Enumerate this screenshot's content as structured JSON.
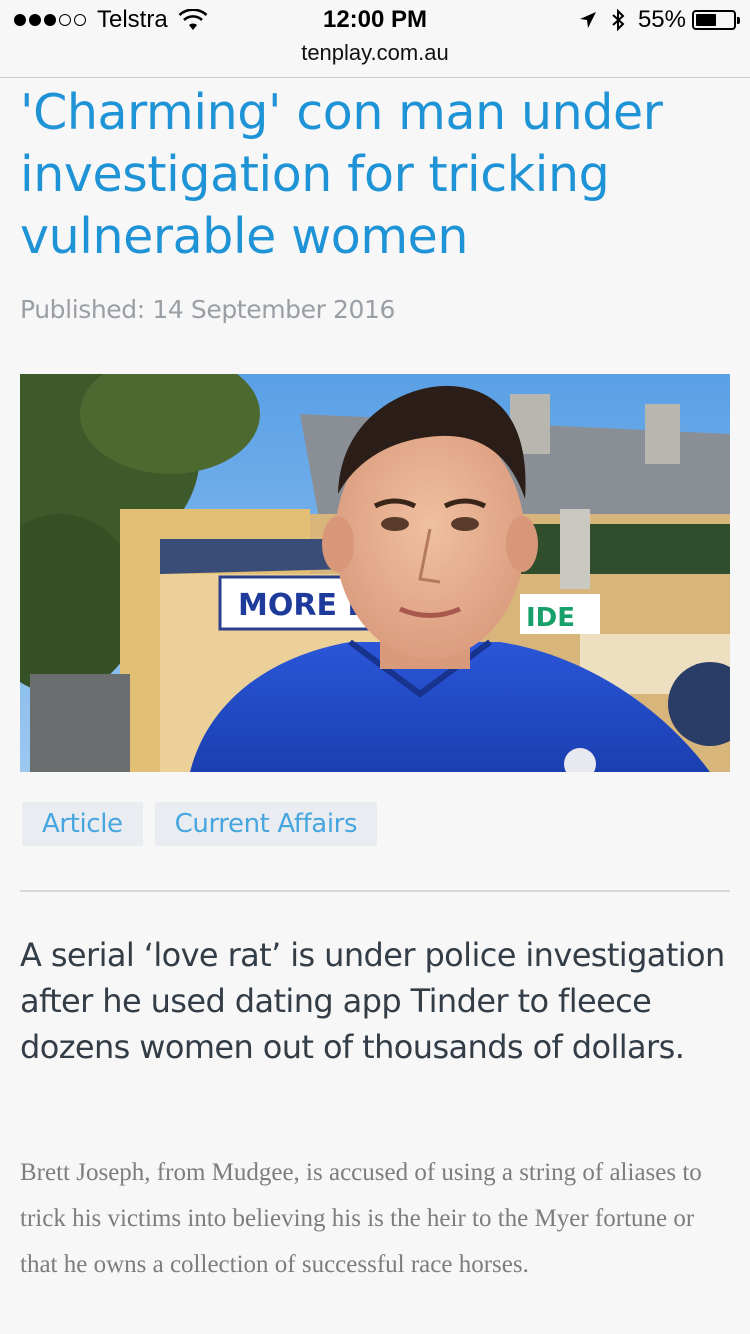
{
  "status_bar": {
    "carrier": "Telstra",
    "time": "12:00 PM",
    "battery": "55%",
    "battery_level": 0.55,
    "signal_bars_filled": 3,
    "signal_bars_total": 5,
    "icons": [
      "signal-dots-icon",
      "wifi-icon",
      "location-arrow-icon",
      "bluetooth-icon",
      "battery-icon"
    ]
  },
  "browser": {
    "url": "tenplay.com.au"
  },
  "article": {
    "headline": "'Charming' con man under investigation for tricking vulnerable women",
    "published": "Published: 14 September 2016",
    "tags": [
      "Article",
      "Current Affairs"
    ],
    "lead": "A serial ‘love rat’ is under police investigation after he used dating app Tinder to fleece dozens women out of thousands of dollars.",
    "body": "Brett Joseph, from Mudgee, is accused of using a string of aliases to trick his victims into believing his is the heir to the Myer fortune or that he owns a collection of successful race horses."
  },
  "hero_image": {
    "sign_text": "MORE E",
    "sign_text_right": "IDE"
  },
  "colors": {
    "headline": "#1e93d6",
    "tag_text": "#47a6df",
    "tag_background": "#e9edf1",
    "published": "#9a9fa5",
    "lead": "#333d47",
    "body": "#7d7d7d"
  }
}
